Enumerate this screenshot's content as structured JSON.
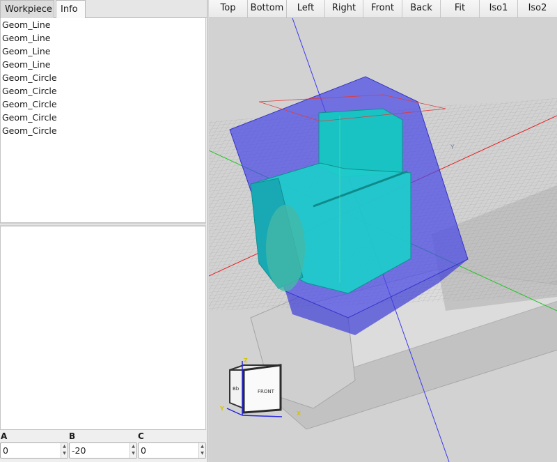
{
  "tabs": [
    {
      "label": "Workpiece",
      "active": false
    },
    {
      "label": "Info",
      "active": true
    }
  ],
  "geometry_list": [
    "Geom_Line",
    "Geom_Line",
    "Geom_Line",
    "Geom_Line",
    "Geom_Circle",
    "Geom_Circle",
    "Geom_Circle",
    "Geom_Circle",
    "Geom_Circle"
  ],
  "fields": {
    "a": {
      "label": "A",
      "value": "0"
    },
    "b": {
      "label": "B",
      "value": "-20"
    },
    "c": {
      "label": "C",
      "value": "0"
    }
  },
  "view_buttons": [
    "Top",
    "Bottom",
    "Left",
    "Right",
    "Front",
    "Back",
    "Fit",
    "Iso1",
    "Iso2"
  ],
  "view_cube": {
    "front_label": "FRONT",
    "side_label": "Bb",
    "axis_x": "X",
    "axis_y": "Y",
    "axis_z": "Z"
  },
  "viewport_marker": "Y",
  "colors": {
    "viewport_bg": "#d2d2d2",
    "stock_box": "#4a4ae6",
    "part": "#19c3c3",
    "axis_x": "#e32222",
    "axis_y": "#22c422",
    "axis_z": "#3a3aee"
  }
}
